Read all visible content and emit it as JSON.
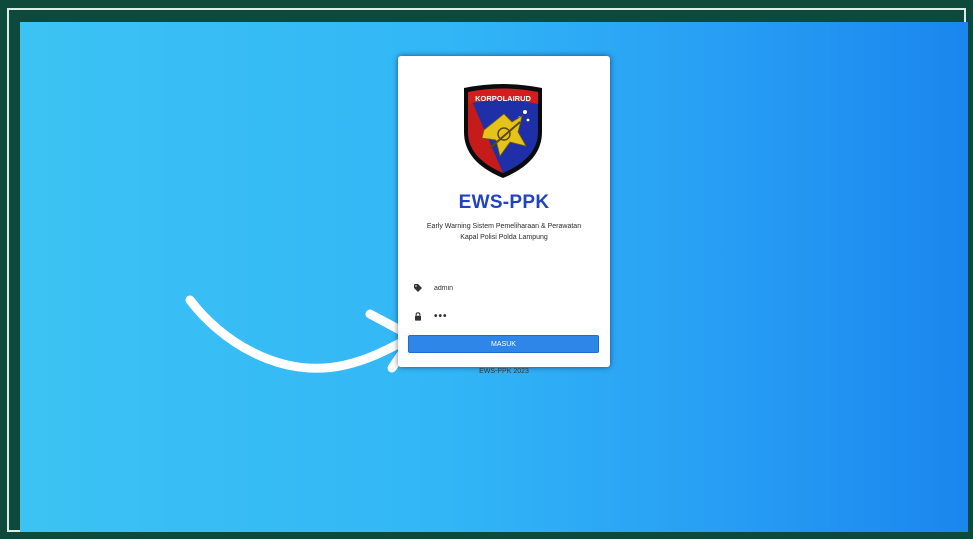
{
  "login": {
    "logo_text": "KORPOLAIRUD",
    "app_title": "EWS-PPK",
    "subtitle_line1": "Early Warning Sistem Pemeliharaan & Perawatan",
    "subtitle_line2": "Kapal Polisi Polda Lampung",
    "username_value": "admin",
    "password_value": "•••",
    "submit_label": "MASUK",
    "footer": "EWS-PPK 2023"
  },
  "icons": {
    "username": "tag-icon",
    "password": "lock-icon",
    "pointer": "curved-arrow-icon"
  },
  "colors": {
    "frame": "#0d4a3c",
    "background_start": "#3cc3f3",
    "background_end": "#1a86ee",
    "title": "#1f43c4",
    "button": "#2d86e8"
  }
}
